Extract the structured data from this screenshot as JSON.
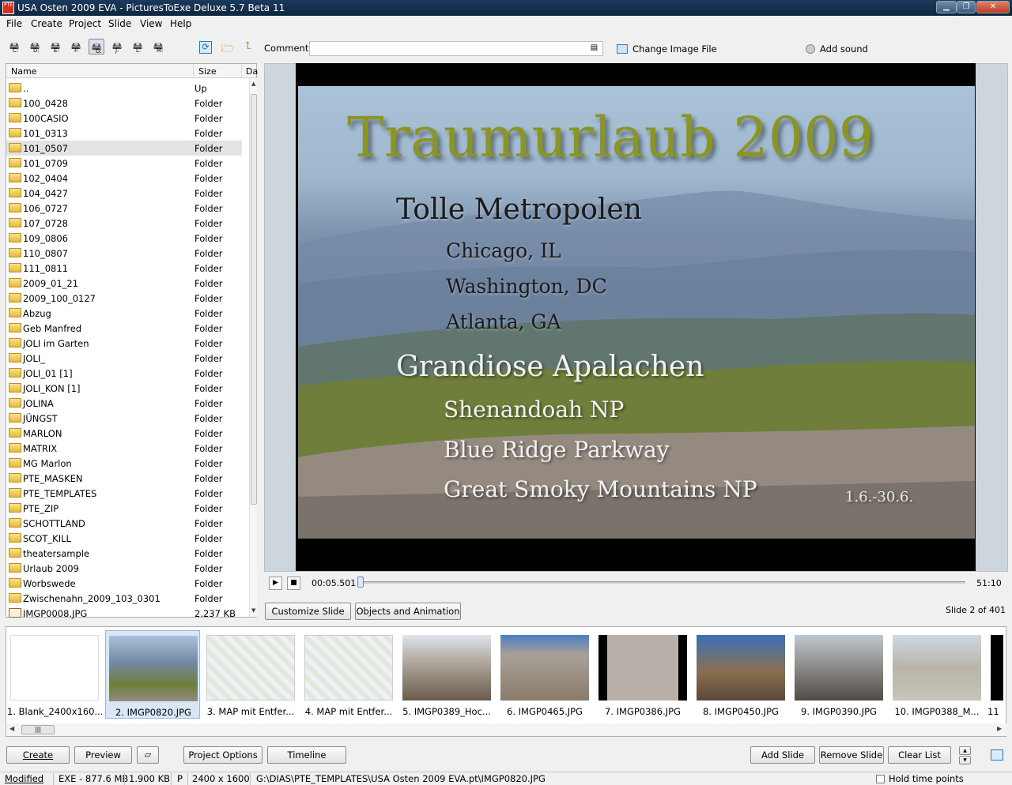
{
  "window": {
    "title": "USA Osten 2009 EVA - PicturesToExe Deluxe 5.7 Beta 11",
    "app_icon": "PTE",
    "min": "▁",
    "max": "❐",
    "close": "✕"
  },
  "menu": [
    "File",
    "Create",
    "Project",
    "Slide",
    "View",
    "Help"
  ],
  "toolbar": {
    "drives": [
      "C:",
      "D:",
      "E:",
      "F:",
      "G:",
      "J:",
      "L:",
      "M:"
    ],
    "selected": "G:",
    "extra_icons": [
      "refresh-icon",
      "folder-open-icon",
      "folder-up-icon"
    ]
  },
  "file_list": {
    "columns": [
      "Name",
      "Size",
      "Da"
    ],
    "rows": [
      {
        "name": "..",
        "size": "Up"
      },
      {
        "name": "100_0428",
        "size": "Folder"
      },
      {
        "name": "100CASIO",
        "size": "Folder"
      },
      {
        "name": "101_0313",
        "size": "Folder"
      },
      {
        "name": "101_0507",
        "size": "Folder",
        "selected": true
      },
      {
        "name": "101_0709",
        "size": "Folder"
      },
      {
        "name": "102_0404",
        "size": "Folder"
      },
      {
        "name": "104_0427",
        "size": "Folder"
      },
      {
        "name": "106_0727",
        "size": "Folder"
      },
      {
        "name": "107_0728",
        "size": "Folder"
      },
      {
        "name": "109_0806",
        "size": "Folder"
      },
      {
        "name": "110_0807",
        "size": "Folder"
      },
      {
        "name": "111_0811",
        "size": "Folder"
      },
      {
        "name": "2009_01_21",
        "size": "Folder"
      },
      {
        "name": "2009_100_0127",
        "size": "Folder"
      },
      {
        "name": "Abzug",
        "size": "Folder"
      },
      {
        "name": "Geb Manfred",
        "size": "Folder"
      },
      {
        "name": "JOLI im Garten",
        "size": "Folder"
      },
      {
        "name": "JOLI_",
        "size": "Folder"
      },
      {
        "name": "JOLI_01 [1]",
        "size": "Folder"
      },
      {
        "name": "JOLI_KON [1]",
        "size": "Folder"
      },
      {
        "name": "JOLINA",
        "size": "Folder"
      },
      {
        "name": "JÜNGST",
        "size": "Folder"
      },
      {
        "name": "MARLON",
        "size": "Folder"
      },
      {
        "name": "MATRIX",
        "size": "Folder"
      },
      {
        "name": "MG Marlon",
        "size": "Folder"
      },
      {
        "name": "PTE_MASKEN",
        "size": "Folder"
      },
      {
        "name": "PTE_TEMPLATES",
        "size": "Folder"
      },
      {
        "name": "PTE_ZIP",
        "size": "Folder"
      },
      {
        "name": "SCHOTTLAND",
        "size": "Folder"
      },
      {
        "name": "SCOT_KILL",
        "size": "Folder"
      },
      {
        "name": "theatersample",
        "size": "Folder"
      },
      {
        "name": "Urlaub 2009",
        "size": "Folder"
      },
      {
        "name": "Worbswede",
        "size": "Folder"
      },
      {
        "name": "Zwischenahn_2009_103_0301",
        "size": "Folder"
      },
      {
        "name": "IMGP0008.JPG",
        "size": "2.237 KB",
        "type": "jpg"
      }
    ]
  },
  "comment": {
    "label": "Comment",
    "value": "",
    "change_image": "Change Image File",
    "add_sound": "Add sound"
  },
  "slide_text": {
    "title": "Traumurlaub 2009",
    "h1": "Tolle Metropolen",
    "c1": "Chicago, IL",
    "c2": "Washington, DC",
    "c3": "Atlanta, GA",
    "h2": "Grandiose Apalachen",
    "p1": "Shenandoah NP",
    "p2": "Blue Ridge Parkway",
    "p3": "Great Smoky Mountains NP",
    "date": "1.6.-30.6."
  },
  "playback": {
    "current": "00:05.501",
    "total": "51:10",
    "position_fraction": 0.0
  },
  "buttons": {
    "customize": "Customize Slide",
    "objects": "Objects and Animation",
    "create": "Create",
    "preview": "Preview",
    "project_options": "Project Options",
    "timeline": "Timeline",
    "add_slide": "Add Slide",
    "remove_slide": "Remove Slide",
    "clear_list": "Clear List"
  },
  "slide_count": "Slide 2 of 401",
  "thumbnails": [
    {
      "caption": "1. Blank_2400x160...",
      "kind": "blank"
    },
    {
      "caption": "2. IMGP0820.JPG",
      "kind": "title",
      "selected": true
    },
    {
      "caption": "3. MAP mit Entfer...",
      "kind": "map"
    },
    {
      "caption": "4. MAP mit Entfer...",
      "kind": "map"
    },
    {
      "caption": "5. IMGP0389_Hoc...",
      "kind": "city1"
    },
    {
      "caption": "6. IMGP0465.JPG",
      "kind": "city2"
    },
    {
      "caption": "7. IMGP0386.JPG",
      "kind": "city3"
    },
    {
      "caption": "8. IMGP0450.JPG",
      "kind": "city4"
    },
    {
      "caption": "9. IMGP0390.JPG",
      "kind": "city5"
    },
    {
      "caption": "10. IMGP0388_M...",
      "kind": "city6"
    },
    {
      "caption": "11",
      "kind": "partial"
    }
  ],
  "status": {
    "state": "Modified",
    "exe": "EXE - 877.6 MB",
    "size": "1.900 KB",
    "p": "P",
    "dims": "2400 x 1600",
    "path": "G:\\DIAS\\PTE_TEMPLATES\\USA Osten 2009 EVA.pt\\IMGP0820.JPG",
    "hold": "Hold time points"
  },
  "colors": {
    "title_text": "#8a9526",
    "titlebar": "#12304e",
    "selected_thumb": "#d8e6f5"
  }
}
